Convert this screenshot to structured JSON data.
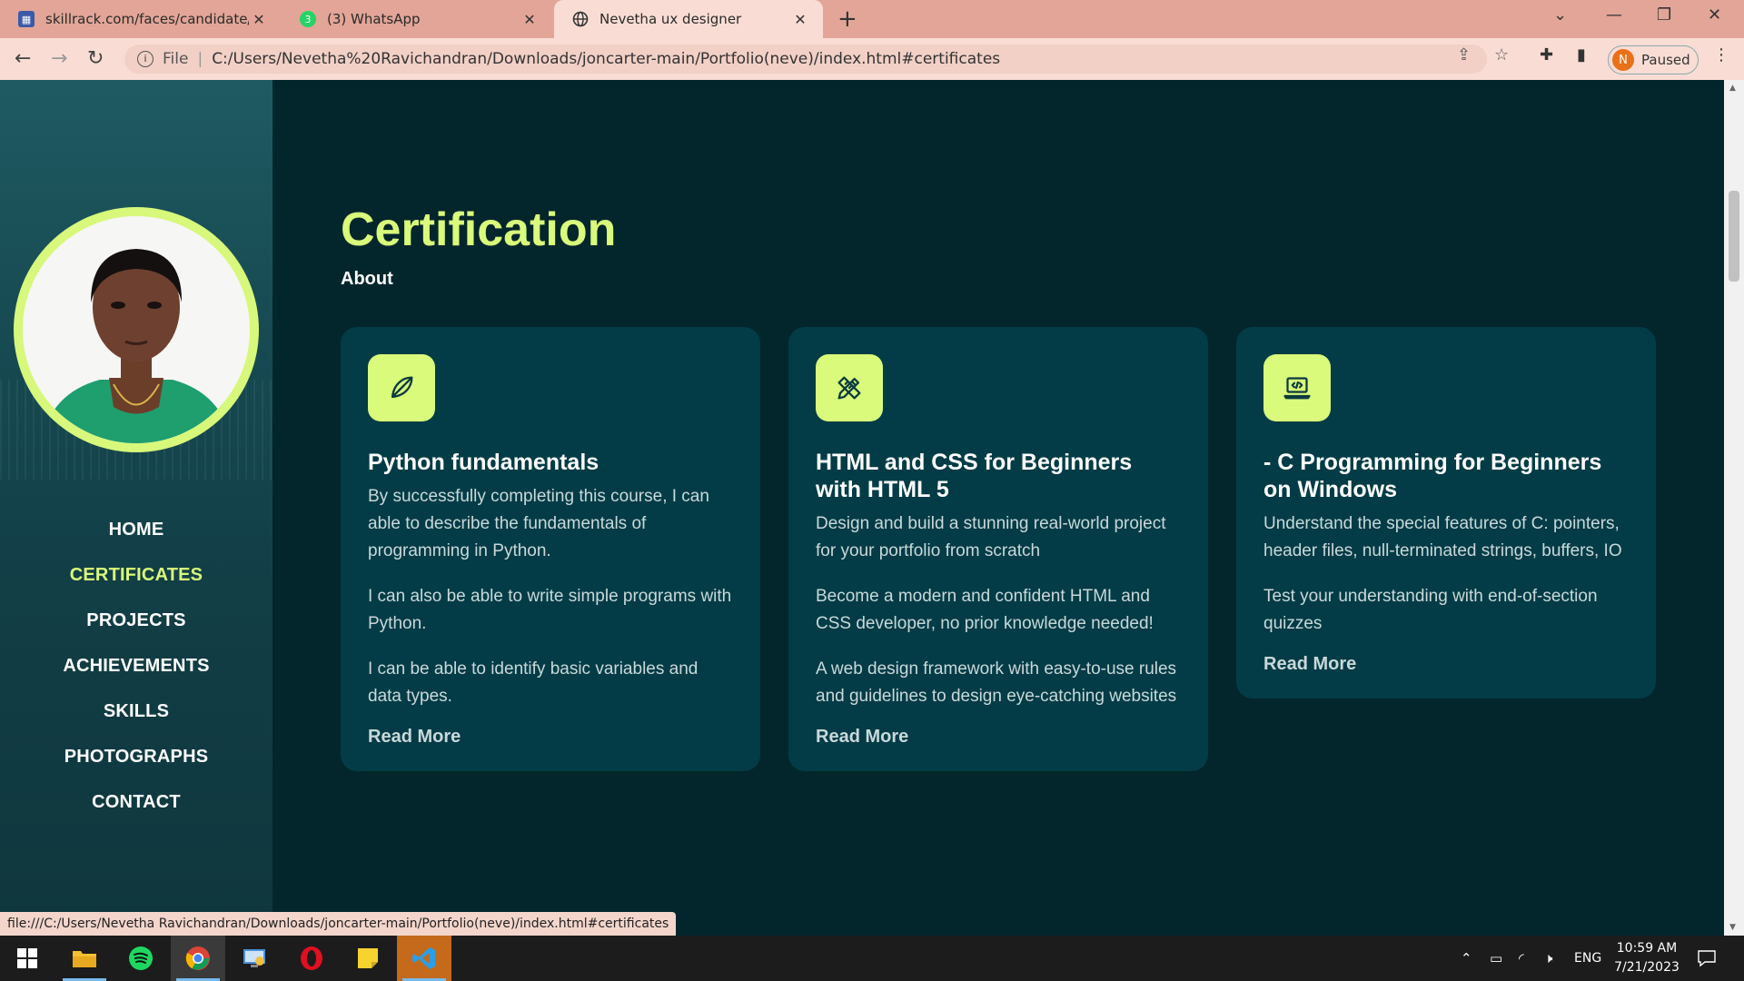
{
  "browser": {
    "tabs": [
      {
        "title": "skillrack.com/faces/candidate/tra",
        "active": false
      },
      {
        "title": "(3) WhatsApp",
        "active": false
      },
      {
        "title": "Nevetha ux designer",
        "active": true
      }
    ],
    "address": {
      "scheme_label": "File",
      "url": "C:/Users/Nevetha%20Ravichandran/Downloads/joncarter-main/Portfolio(neve)/index.html#certificates"
    },
    "profile": {
      "initial": "N",
      "status": "Paused"
    },
    "status_url": "file:///C:/Users/Nevetha Ravichandran/Downloads/joncarter-main/Portfolio(neve)/index.html#certificates"
  },
  "sidebar": {
    "nav": [
      {
        "label": "HOME",
        "active": false
      },
      {
        "label": "CERTIFICATES",
        "active": true
      },
      {
        "label": "PROJECTS",
        "active": false
      },
      {
        "label": "ACHIEVEMENTS",
        "active": false
      },
      {
        "label": "SKILLS",
        "active": false
      },
      {
        "label": "PHOTOGRAPHS",
        "active": false
      },
      {
        "label": "CONTACT",
        "active": false
      }
    ]
  },
  "main": {
    "heading": "Certification",
    "subheading": "About",
    "cards": [
      {
        "icon": "feather-pen-icon",
        "title": "Python fundamentals",
        "paragraphs": [
          "By successfully completing this course, I can able to describe the fundamentals of programming in Python.",
          "I can also be able to write simple programs with Python.",
          "I can be able to identify basic variables and data types."
        ],
        "link": "Read More"
      },
      {
        "icon": "pencil-ruler-icon",
        "title": "HTML and CSS for Beginners with HTML 5",
        "paragraphs": [
          "Design and build a stunning real-world project for your portfolio from scratch",
          "Become a modern and confident HTML and CSS developer, no prior knowledge needed!",
          "A web design framework with easy-to-use rules and guidelines to design eye-catching websites"
        ],
        "link": "Read More"
      },
      {
        "icon": "laptop-code-icon",
        "title": "- C Programming for Beginners on Windows",
        "paragraphs": [
          "Understand the special features of C: pointers, header files, null-terminated strings, buffers, IO",
          "Test your understanding with end-of-section quizzes"
        ],
        "link": "Read More"
      }
    ]
  },
  "taskbar": {
    "language": "ENG",
    "time": "10:59 AM",
    "date": "7/21/2023"
  },
  "colors": {
    "accent": "#d9fa7a",
    "page_bg": "#03262d",
    "card_bg": "#033c46",
    "chrome": "#f9ddd5"
  }
}
